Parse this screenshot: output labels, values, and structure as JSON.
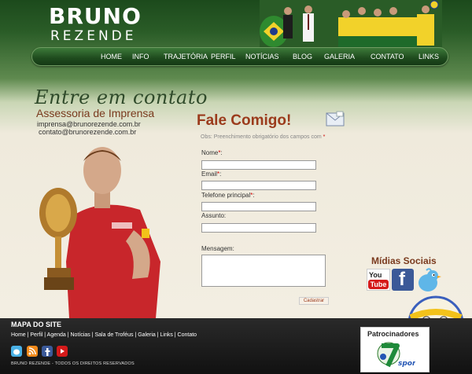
{
  "header": {
    "logo_line1": "BRUNO",
    "logo_line2": "REZENDE"
  },
  "nav": {
    "items": [
      "HOME",
      "INFO",
      "TRAJETÓRIA",
      "PERFIL",
      "NOTÍCIAS",
      "BLOG",
      "GALERIA",
      "CONTATO",
      "LINKS"
    ]
  },
  "contact": {
    "heading": "Entre em contato",
    "subheading": "Assessoria de Imprensa",
    "emails": [
      "imprensa@brunorezende.com.br",
      "contato@brunorezende.com.br"
    ]
  },
  "form": {
    "title": "Fale Comigo!",
    "obs": "Obs: Preenchimento obrigatório dos campos com",
    "required_mark": "*",
    "fields": {
      "nome": "Nome",
      "email": "Email",
      "telefone": "Telefone principal",
      "assunto": "Assunto:",
      "mensagem": "Mensagem:"
    },
    "submit_label": "Cadastrar"
  },
  "social": {
    "title": "Mídias Sociais",
    "youtube": "You Tube",
    "facebook": "f"
  },
  "footer": {
    "sitemap_title": "MAPA DO SITE",
    "links": "Home | Perfil | Agenda | Notícias | Sala de Troféus | Galeria | Links | Contato",
    "copyright": "BRUNO REZENDE - TODOS OS DIREITOS RESERVADOS",
    "sponsors_title": "Patrocinadores",
    "sponsor_name": "sports"
  },
  "colors": {
    "dark_green": "#1e4a1d",
    "accent_brown": "#9b3b1c",
    "required_red": "#cc0000"
  }
}
